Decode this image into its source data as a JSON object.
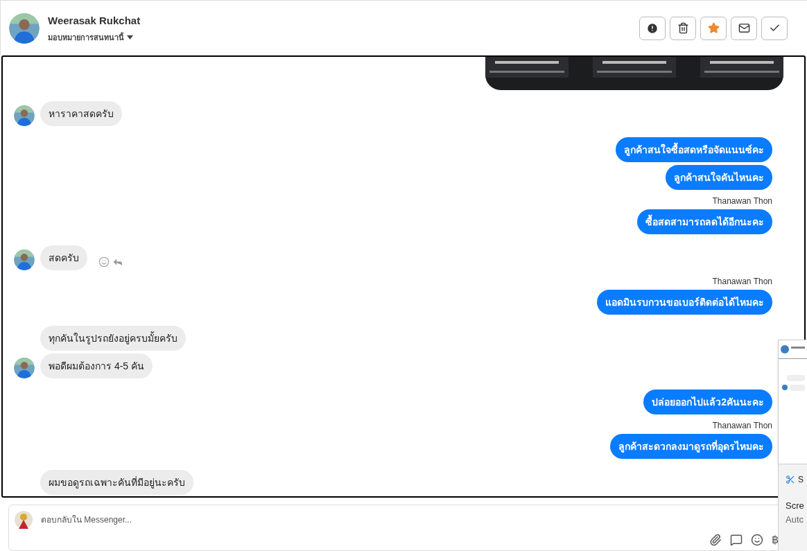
{
  "header": {
    "name": "Weerasak Rukchat",
    "assign_label": "มอบหมายการสนทนานี้",
    "actions": [
      {
        "kind": "alert"
      },
      {
        "kind": "trash"
      },
      {
        "kind": "star",
        "on": true
      },
      {
        "kind": "mail"
      },
      {
        "kind": "check"
      }
    ]
  },
  "messages": [
    {
      "kind": "picture"
    },
    {
      "kind": "incoming",
      "text": "หาราคาสดครับ",
      "avatar": true,
      "actions": false
    },
    {
      "kind": "outgoing",
      "text": "ลูกค้าสนใจซื้อสดหรือจัดแนนซ์คะ"
    },
    {
      "kind": "outgoing",
      "text": "ลูกค้าสนใจคันไหนคะ"
    },
    {
      "kind": "sender",
      "text": "Thanawan Thon"
    },
    {
      "kind": "outgoing",
      "text": "ซื้อสดสามารถลดได้อีกนะคะ"
    },
    {
      "kind": "incoming",
      "text": "สดครับ",
      "avatar": true,
      "actions": true
    },
    {
      "kind": "sender",
      "text": "Thanawan Thon"
    },
    {
      "kind": "outgoing",
      "text": "แอดมินรบกวนขอเบอร์ติดต่อได้ไหมคะ"
    },
    {
      "kind": "incoming",
      "text": "ทุกคันในรูปรถยังอยู่ครบมั้ยครับ",
      "avatar": false,
      "actions": false
    },
    {
      "kind": "incoming",
      "text": "พอดีผมต้องการ 4-5 คัน",
      "avatar": true,
      "actions": false
    },
    {
      "kind": "outgoing",
      "text": "ปล่อยออกไปแล้ว2คันนะคะ"
    },
    {
      "kind": "sender",
      "text": "Thanawan Thon"
    },
    {
      "kind": "outgoing",
      "text": "ลูกค้าสะดวกลงมาดูรถที่อุดรไหมคะ"
    },
    {
      "kind": "incoming",
      "text": "ผมขอดูรถเฉพาะคันที่มีอยู่นะครับ",
      "avatar": false,
      "actions": false
    }
  ],
  "composer": {
    "placeholder": "ตอบกลับใน Messenger...",
    "currency_symbol": "฿"
  },
  "notification": {
    "app_initial": "S",
    "title": "Scre",
    "body": "Autc"
  }
}
